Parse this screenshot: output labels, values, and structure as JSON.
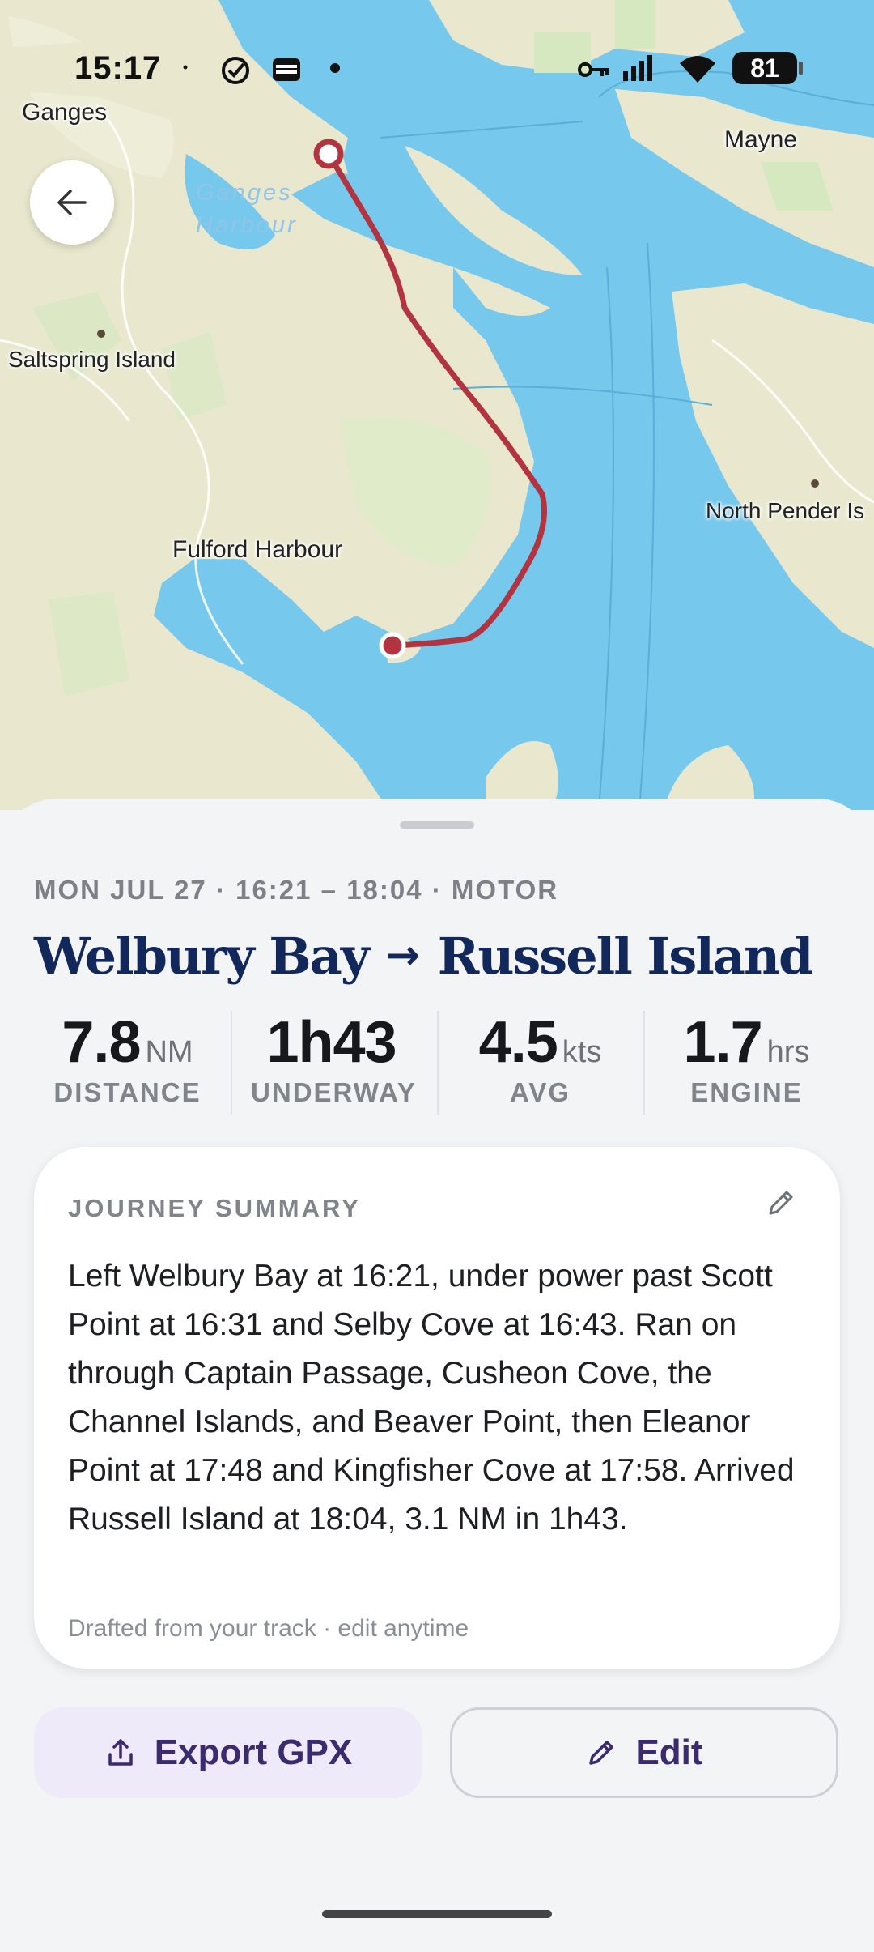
{
  "status_bar": {
    "time": "15:17",
    "battery": "81",
    "icons": [
      "dot-icon",
      "check-circle-icon",
      "wallet-icon",
      "dot-icon",
      "key-icon",
      "signal-icon",
      "wifi-icon",
      "battery-icon"
    ]
  },
  "map": {
    "labels": {
      "ganges": "Ganges",
      "mayne": "Mayne",
      "saltspring": "Saltspring Island",
      "north_pender": "North Pender Is",
      "fulford": "Fulford Harbour",
      "ganges_harbour_line1": "Ganges",
      "ganges_harbour_line2": "Harbour"
    },
    "colors": {
      "water": "#76c8ec",
      "land": "#ecebd6",
      "track": "#b23441"
    }
  },
  "trip": {
    "meta": "MON JUL 27 · 16:21 – 18:04 · MOTOR",
    "from": "Welbury Bay",
    "arrow": "→",
    "to": "Russell Island"
  },
  "stats": [
    {
      "value": "7.8",
      "unit": "NM",
      "label": "DISTANCE"
    },
    {
      "value": "1h43",
      "unit": "",
      "label": "UNDERWAY"
    },
    {
      "value": "4.5",
      "unit": "kts",
      "label": "AVG"
    },
    {
      "value": "1.7",
      "unit": "hrs",
      "label": "ENGINE"
    }
  ],
  "summary": {
    "heading": "JOURNEY SUMMARY",
    "text": "Left Welbury Bay at 16:21, under power past Scott Point at 16:31 and Selby Cove at 16:43. Ran on through Captain Passage, Cusheon Cove, the Channel Islands, and Beaver Point, then Eleanor Point at 17:48 and Kingfisher Cove at 17:58. Arrived Russell Island at 18:04, 3.1 NM in 1h43.",
    "footnote": "Drafted from your track · edit anytime"
  },
  "actions": {
    "export_label": "Export GPX",
    "edit_label": "Edit"
  }
}
